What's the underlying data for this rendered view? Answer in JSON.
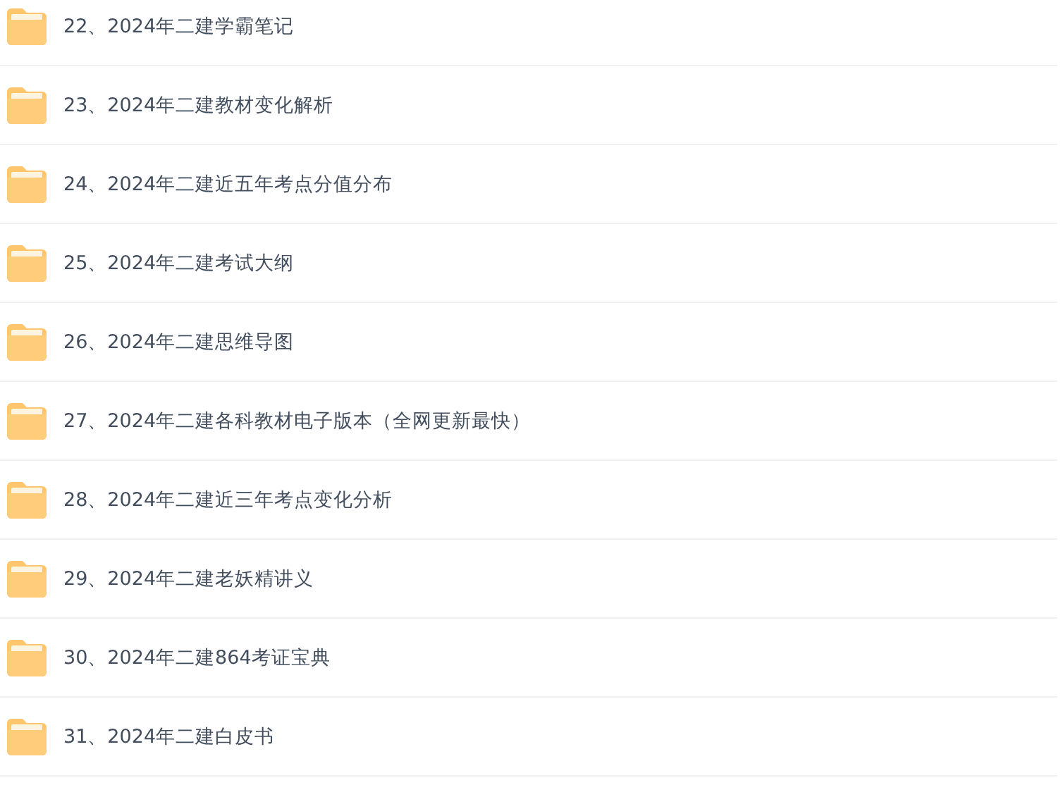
{
  "folders": [
    {
      "name": "22、2024年二建学霸笔记"
    },
    {
      "name": "23、2024年二建教材变化解析"
    },
    {
      "name": "24、2024年二建近五年考点分值分布"
    },
    {
      "name": "25、2024年二建考试大纲"
    },
    {
      "name": "26、2024年二建思维导图"
    },
    {
      "name": "27、2024年二建各科教材电子版本（全网更新最快）"
    },
    {
      "name": "28、2024年二建近三年考点变化分析"
    },
    {
      "name": "29、2024年二建老妖精讲义"
    },
    {
      "name": "30、2024年二建864考证宝典"
    },
    {
      "name": "31、2024年二建白皮书"
    }
  ]
}
